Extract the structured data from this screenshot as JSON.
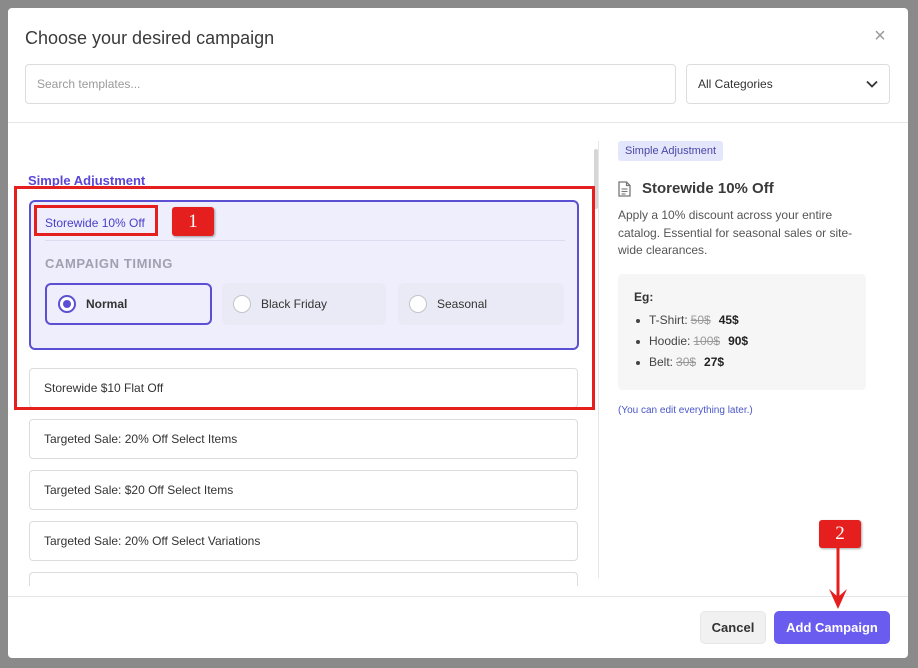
{
  "modal": {
    "title": "Choose your desired campaign",
    "close_glyph": "×",
    "search_placeholder": "Search templates...",
    "category_select": {
      "value": "All Categories",
      "icon": "chevron-down-icon"
    }
  },
  "templates": {
    "section_heading": "Simple Adjustment",
    "selected": {
      "title": "Storewide 10% Off",
      "timing_label": "CAMPAIGN TIMING",
      "timing_options": [
        {
          "label": "Normal",
          "selected": true
        },
        {
          "label": "Black Friday",
          "selected": false
        },
        {
          "label": "Seasonal",
          "selected": false
        }
      ]
    },
    "items": [
      "Storewide $10 Flat Off",
      "Targeted Sale: 20% Off Select Items",
      "Targeted Sale: $20 Off Select Items",
      "Targeted Sale: 20% Off Select Variations"
    ]
  },
  "preview": {
    "badge": "Simple Adjustment",
    "icon": "document-icon",
    "title": "Storewide 10% Off",
    "description": "Apply a 10% discount across your entire catalog. Essential for seasonal sales or site-wide clearances.",
    "example": {
      "title": "Eg:",
      "items": [
        {
          "name": "T-Shirt:",
          "old": "50$",
          "new": "45$"
        },
        {
          "name": "Hoodie:",
          "old": "100$",
          "new": "90$"
        },
        {
          "name": "Belt:",
          "old": "30$",
          "new": "27$"
        }
      ]
    },
    "note": "(You can edit everything later.)"
  },
  "footer": {
    "cancel": "Cancel",
    "add": "Add Campaign"
  },
  "annotations": {
    "step1": "1",
    "step2": "2",
    "color": "#e51e1e"
  },
  "colors": {
    "accent": "#5b4fd3",
    "primary_button": "#6b5cf0"
  }
}
